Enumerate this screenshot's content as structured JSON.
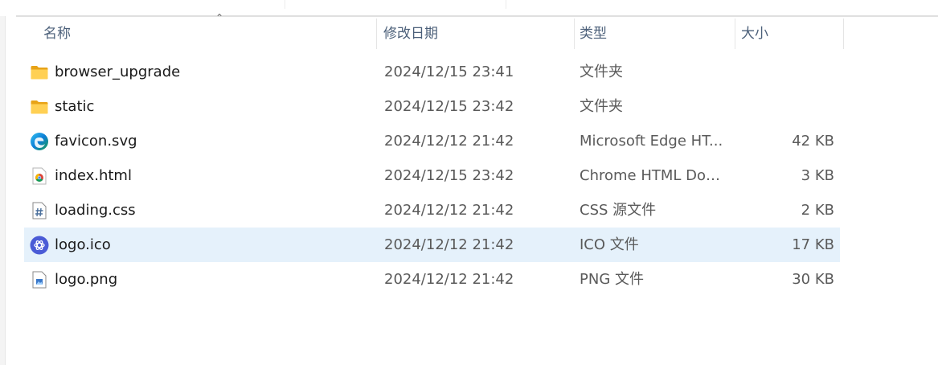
{
  "columns": {
    "name": "名称",
    "date": "修改日期",
    "type": "类型",
    "size": "大小"
  },
  "sort_indicator": "⌃",
  "files": [
    {
      "icon": "folder-icon",
      "name": "browser_upgrade",
      "date": "2024/12/15 23:41",
      "type": "文件夹",
      "size": ""
    },
    {
      "icon": "folder-icon",
      "name": "static",
      "date": "2024/12/15 23:42",
      "type": "文件夹",
      "size": ""
    },
    {
      "icon": "edge-icon",
      "name": "favicon.svg",
      "date": "2024/12/12 21:42",
      "type": "Microsoft Edge HT...",
      "size": "42 KB"
    },
    {
      "icon": "chrome-html-icon",
      "name": "index.html",
      "date": "2024/12/15 23:42",
      "type": "Chrome HTML Doc...",
      "size": "3 KB"
    },
    {
      "icon": "css-file-icon",
      "name": "loading.css",
      "date": "2024/12/12 21:42",
      "type": "CSS 源文件",
      "size": "2 KB"
    },
    {
      "icon": "openai-logo-icon",
      "name": "logo.ico",
      "date": "2024/12/12 21:42",
      "type": "ICO 文件",
      "size": "17 KB",
      "selected": true
    },
    {
      "icon": "image-file-icon",
      "name": "logo.png",
      "date": "2024/12/12 21:42",
      "type": "PNG 文件",
      "size": "30 KB"
    }
  ]
}
